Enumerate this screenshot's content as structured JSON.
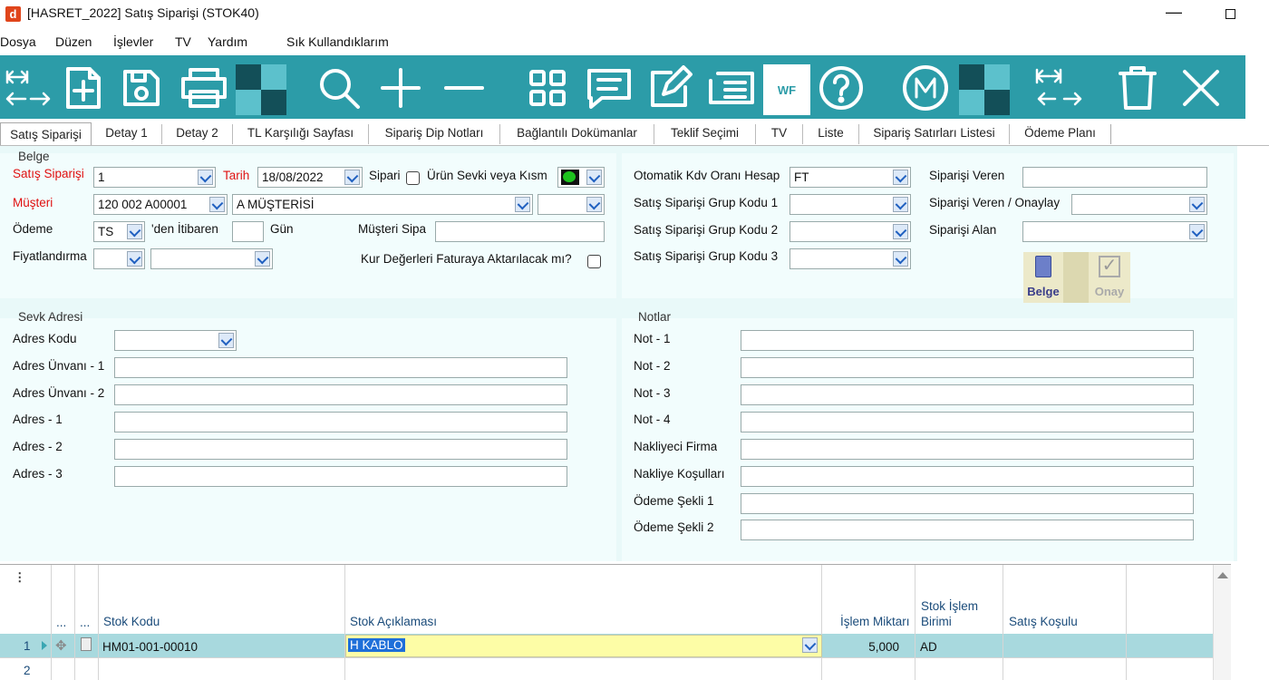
{
  "window": {
    "logo": "d",
    "title": "[HASRET_2022] Satış Siparişi (STOK40)",
    "min": "—"
  },
  "menu": [
    "Dosya",
    "Düzen",
    "İşlevler",
    "TV",
    "Yardım",
    "Sık Kullandıklarım"
  ],
  "toolbar": {
    "wf_label": "WF",
    "accent": "#2c9ca8"
  },
  "tabs": [
    "Satış Siparişi",
    "Detay 1",
    "Detay 2",
    "TL Karşılığı Sayfası",
    "Sipariş Dip Notları",
    "Bağlantılı Dokümanlar",
    "Teklif Seçimi",
    "TV",
    "Liste",
    "Sipariş Satırları Listesi",
    "Ödeme Planı"
  ],
  "belge": {
    "title": "Belge",
    "siparis_label": "Satış Siparişi",
    "siparis_value": "1",
    "tarih_label": "Tarih",
    "tarih_value": "18/08/2022",
    "sipari_label": "Sipari",
    "urun_label": "Ürün Sevki veya Kısm",
    "musteri_label": "Müşteri",
    "musteri_code": "120 002 A00001",
    "musteri_name": "A MÜŞTERİSİ",
    "odeme_label": "Ödeme",
    "odeme_value": "TS",
    "itibaren_label": "'den İtibaren",
    "gun_label": "Gün",
    "musteri_sipa_label": "Müşteri Sipa",
    "fiyat_label": "Fiyatlandırma",
    "kur_label": "Kur Değerleri Faturaya Aktarılacak mı?",
    "kdv_label": "Otomatik Kdv Oranı Hesap",
    "kdv_value": "FT",
    "grup1_label": "Satış Siparişi Grup Kodu 1",
    "grup2_label": "Satış Siparişi Grup Kodu 2",
    "grup3_label": "Satış Siparişi Grup Kodu 3",
    "veren_label": "Siparişi Veren",
    "onaylay_label": "Siparişi Veren / Onaylay",
    "alan_label": "Siparişi Alan",
    "belge_btn": "Belge",
    "onay_btn": "Onay"
  },
  "sevk": {
    "title": "Sevk Adresi",
    "fields": [
      "Adres Kodu",
      "Adres Ünvanı - 1",
      "Adres Ünvanı - 2",
      "Adres - 1",
      "Adres - 2",
      "Adres - 3"
    ]
  },
  "notlar": {
    "title": "Notlar",
    "fields": [
      "Not - 1",
      "Not - 2",
      "Not - 3",
      "Not - 4",
      "Nakliyeci Firma",
      "Nakliye Koşulları",
      "Ödeme Şekli 1",
      "Ödeme Şekli 2"
    ]
  },
  "grid": {
    "menu_glyph": "⋮",
    "dots1": "...",
    "dots2": "...",
    "headers": {
      "stok_kodu": "Stok Kodu",
      "stok_aciklama": "Stok Açıklaması",
      "islem_miktari": "İşlem Miktarı",
      "birim": "Stok İşlem Birimi",
      "kosul": "Satış Koşulu"
    },
    "rows": [
      {
        "no": "1",
        "stok_kodu": "HM01-001-00010",
        "aciklama": "H KABLO",
        "miktar": "5,000",
        "birim": "AD"
      },
      {
        "no": "2"
      }
    ]
  }
}
